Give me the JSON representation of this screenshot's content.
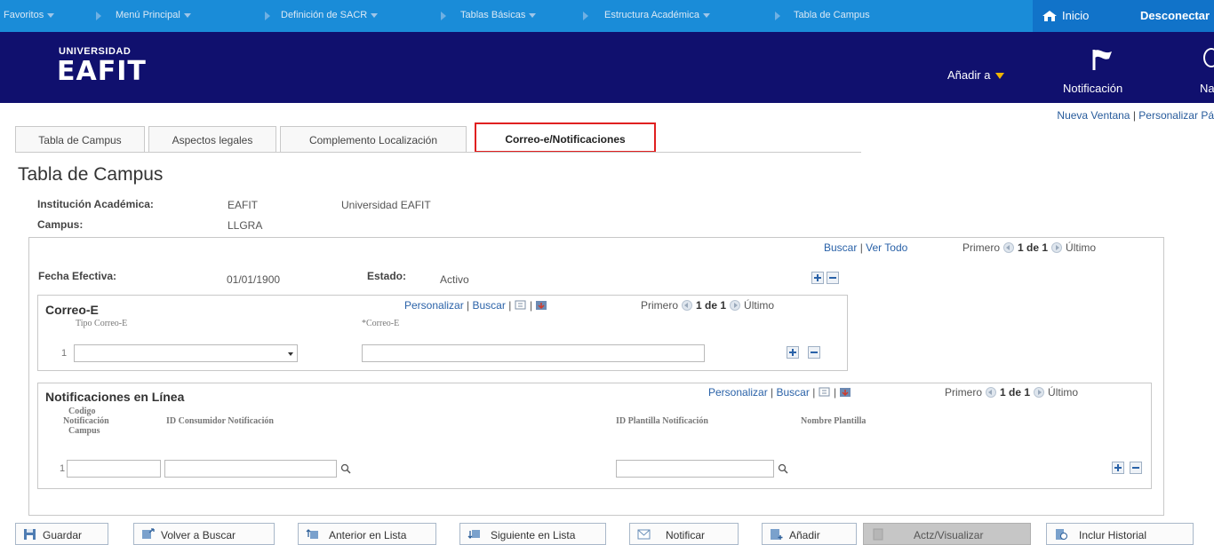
{
  "topnav": {
    "favorites": "Favoritos",
    "main_menu": "Menú Principal",
    "crumbs": [
      "Definición de SACR",
      "Tablas Básicas",
      "Estructura Académica",
      "Tabla de Campus"
    ],
    "home": "Inicio",
    "disconnect": "Desconectar"
  },
  "banner": {
    "logo_top": "UNIVERSIDAD",
    "logo_main": "EAFIT",
    "add_to": "Añadir a",
    "notifications": "Notificación",
    "nav_label": "Na"
  },
  "toplinks": {
    "new_window": "Nueva Ventana",
    "personalize": "Personalizar Pá"
  },
  "tabs": [
    {
      "label": "Tabla de Campus"
    },
    {
      "label": "Aspectos legales"
    },
    {
      "label": "Complemento Localización"
    },
    {
      "label": "Correo-e/Notificaciones",
      "active": true
    }
  ],
  "page": {
    "title": "Tabla de Campus",
    "institution_label": "Institución Académica:",
    "institution_code": "EAFIT",
    "institution_name": "Universidad EAFIT",
    "campus_label": "Campus:",
    "campus_value": "LLGRA"
  },
  "main_nav": {
    "search": "Buscar",
    "view_all": "Ver Todo",
    "first": "Primero",
    "range": "1 de 1",
    "last": "Último"
  },
  "effective": {
    "date_label": "Fecha Efectiva:",
    "date_value": "01/01/1900",
    "status_label": "Estado:",
    "status_value": "Activo"
  },
  "email_grid": {
    "title": "Correo-E",
    "personalize": "Personalizar",
    "search": "Buscar",
    "first": "Primero",
    "range": "1 de 1",
    "last": "Último",
    "col_type": "Tipo Correo-E",
    "col_email": "*Correo-E",
    "row_num": "1",
    "type_value": "",
    "email_value": ""
  },
  "notif_grid": {
    "title": "Notificaciones en Línea",
    "personalize": "Personalizar",
    "search": "Buscar",
    "first": "Primero",
    "range": "1 de 1",
    "last": "Último",
    "col_code_1": "Codigo",
    "col_code_2": "Notificación",
    "col_code_3": "Campus",
    "col_consumer": "ID Consumidor Notificación",
    "col_template": "ID Plantilla Notificación",
    "col_template_name": "Nombre Plantilla",
    "row_num": "1"
  },
  "buttons": {
    "save": "Guardar",
    "return_search": "Volver a Buscar",
    "prev_list": "Anterior en Lista",
    "next_list": "Siguiente en Lista",
    "notify": "Notificar",
    "add": "Añadir",
    "update_display": "Actz/Visualizar",
    "include_history": "Inclur Historial"
  }
}
